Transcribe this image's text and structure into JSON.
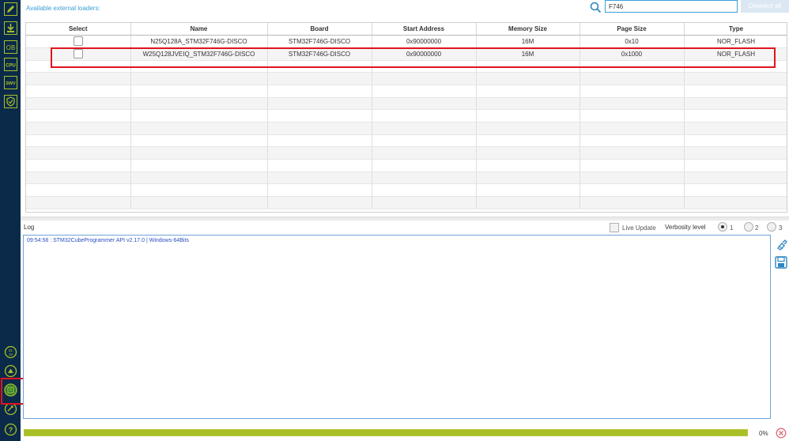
{
  "top": {
    "title": "Available external loaders:",
    "search_value": "F746",
    "deselect_label": "Deselect all"
  },
  "table": {
    "headers": [
      "Select",
      "Name",
      "Board",
      "Start Address",
      "Memory Size",
      "Page Size",
      "Type"
    ],
    "rows": [
      {
        "name": "N25Q128A_STM32F746G-DISCO",
        "board": "STM32F746G-DISCO",
        "start": "0x90000000",
        "memory": "16M",
        "page": "0x10",
        "type": "NOR_FLASH"
      },
      {
        "name": "W25Q128JVEIQ_STM32F746G-DISCO",
        "board": "STM32F746G-DISCO",
        "start": "0x90000000",
        "memory": "16M",
        "page": "0x1000",
        "type": "NOR_FLASH"
      }
    ]
  },
  "log": {
    "title": "Log",
    "live_update": "Live Update",
    "verbosity_label": "Verbosity level",
    "verbosity_options": [
      "1",
      "2",
      "3"
    ],
    "selected_verbosity": "1",
    "line": "09:54:58 : STM32CubeProgrammer API v2.17.0 | Windows-64Bits"
  },
  "progress": {
    "text": "0%",
    "value_percent": 100
  },
  "sidebar": {
    "icons": [
      "pencil-icon",
      "download-icon",
      "ob-icon",
      "cpu-icon",
      "swv-icon",
      "security-icon",
      "otp-icon",
      "rss-icon",
      "external-loader-icon",
      "secure-icon",
      "help-icon"
    ],
    "labels": {
      "ob": "OB",
      "cpu": "CPU",
      "swv": "SWV"
    }
  },
  "colors": {
    "sidebar": "#0b2a4a",
    "accent_green": "#a8c026",
    "accent_blue": "#3aa0d8",
    "highlight": "#e0141e"
  }
}
